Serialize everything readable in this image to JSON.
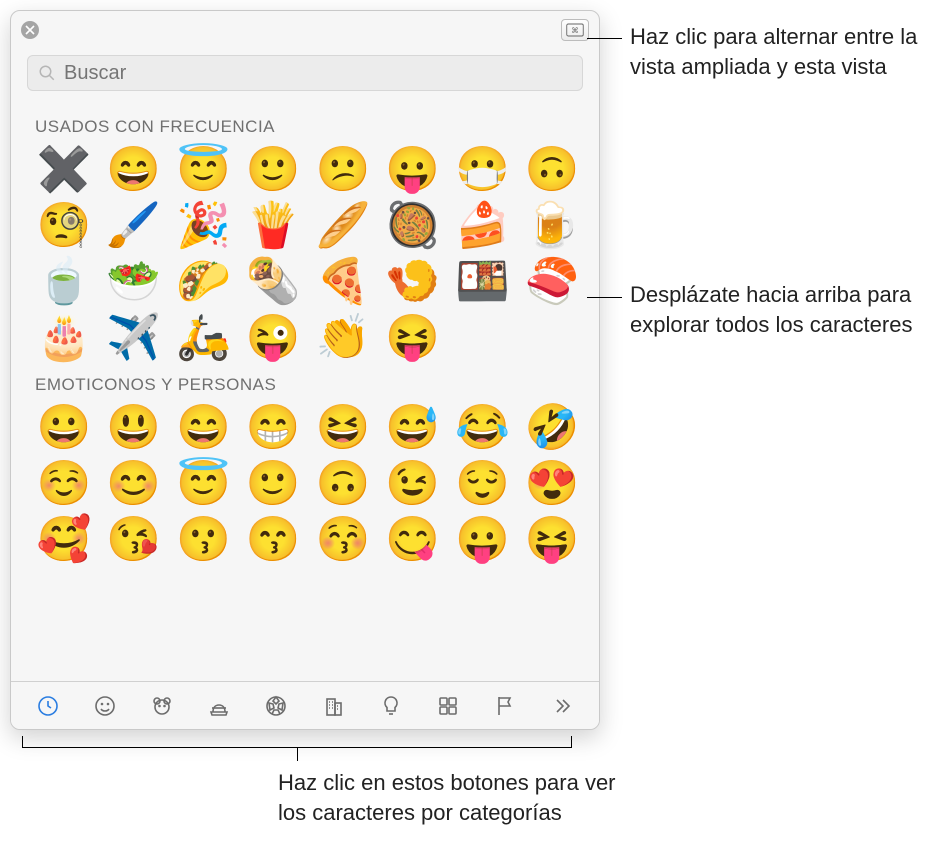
{
  "search": {
    "placeholder": "Buscar"
  },
  "sections": {
    "frequently_used": {
      "title": "USADOS CON FRECUENCIA",
      "emojis": [
        "✖️",
        "😄",
        "😇",
        "🙂",
        "😕",
        "😛",
        "😷",
        "🙃",
        "🧐",
        "🖌️",
        "🎉",
        "🍟",
        "🥖",
        "🥘",
        "🍰",
        "🍺",
        "🍵",
        "🥗",
        "🌮",
        "🌯",
        "🍕",
        "🍤",
        "🍱",
        "🍣",
        "🎂",
        "✈️",
        "🛵",
        "😜",
        "👏",
        "😝"
      ]
    },
    "smileys_people": {
      "title": "EMOTICONOS Y PERSONAS",
      "emojis": [
        "😀",
        "😃",
        "😄",
        "😁",
        "😆",
        "😅",
        "😂",
        "🤣",
        "☺️",
        "😊",
        "😇",
        "🙂",
        "🙃",
        "😉",
        "😌",
        "😍",
        "🥰",
        "😘",
        "😗",
        "😙",
        "😚",
        "😋",
        "😛",
        "😝"
      ]
    }
  },
  "categories": [
    {
      "name": "recent",
      "active": true
    },
    {
      "name": "smileys",
      "active": false
    },
    {
      "name": "animals",
      "active": false
    },
    {
      "name": "food",
      "active": false
    },
    {
      "name": "activity",
      "active": false
    },
    {
      "name": "travel",
      "active": false
    },
    {
      "name": "objects",
      "active": false
    },
    {
      "name": "symbols",
      "active": false
    },
    {
      "name": "flags",
      "active": false
    },
    {
      "name": "more",
      "active": false
    }
  ],
  "callouts": {
    "toggle_view": "Haz clic para alternar entre la vista ampliada y esta vista",
    "scroll_hint": "Desplázate hacia arriba para explorar todos los caracteres",
    "category_hint": "Haz clic en estos botones para ver los caracteres por categorías"
  }
}
